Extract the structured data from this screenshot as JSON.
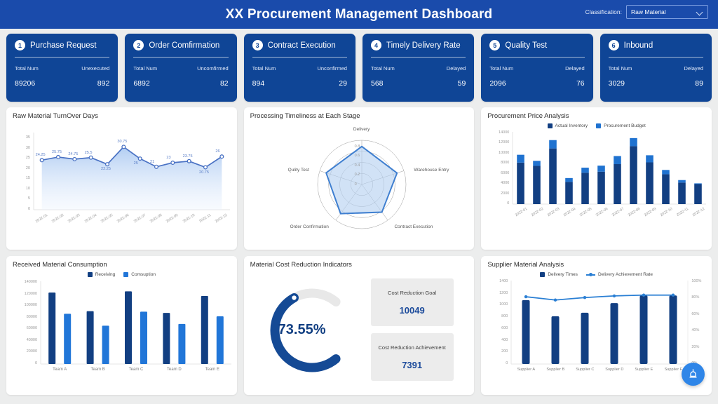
{
  "header": {
    "title": "XX Procurement Management Dashboard",
    "classification_label": "Classification:",
    "classification_value": "Raw Material",
    "chevron_icon": "chevron-down-icon",
    "bg_color": "#1a4bab"
  },
  "kpi_cards": [
    {
      "num": "1",
      "title": "Purchase Request",
      "left_label": "Total Num",
      "left_value": "89206",
      "right_label": "Unexecuted",
      "right_value": "892"
    },
    {
      "num": "2",
      "title": "Order Comfirmation",
      "left_label": "Total Num",
      "left_value": "6892",
      "right_label": "Uncomfirmed",
      "right_value": "82"
    },
    {
      "num": "3",
      "title": "Contract Execution",
      "left_label": "Total Num",
      "left_value": "894",
      "right_label": "Unconfirmed",
      "right_value": "29"
    },
    {
      "num": "4",
      "title": "Timely Delivery Rate",
      "left_label": "Total Num",
      "left_value": "568",
      "right_label": "Delayed",
      "right_value": "59"
    },
    {
      "num": "5",
      "title": "Quality Test",
      "left_label": "Total Num",
      "left_value": "2096",
      "right_label": "Delayed",
      "right_value": "76"
    },
    {
      "num": "6",
      "title": "Inbound",
      "left_label": "Total Num",
      "left_value": "3029",
      "right_label": "Delayed",
      "right_value": "89"
    }
  ],
  "fab": {
    "icon": "alarm-icon",
    "color": "#2f86e8"
  },
  "chart_data": [
    {
      "id": "turnover",
      "type": "line",
      "title": "Raw Material TurnOver Days",
      "xlabel": "",
      "ylabel": "",
      "ylim": [
        0,
        35
      ],
      "yticks": [
        0,
        5,
        10,
        15,
        20,
        25,
        30,
        35
      ],
      "grid": false,
      "legend": "none",
      "area_fill": true,
      "color": "#4a72c4",
      "categories": [
        "2022-01",
        "2022-02",
        "2022-03",
        "2022-04",
        "2022-05",
        "2022-06",
        "2022-07",
        "2022-08",
        "2022-09",
        "2022-10",
        "2022-11",
        "2022-12"
      ],
      "values": [
        24.25,
        25.75,
        24.75,
        25.5,
        22.25,
        30.75,
        25,
        21,
        23,
        23.75,
        20.75,
        26
      ],
      "point_labels": [
        "24.25",
        "25.75",
        "24.75",
        "25.5",
        "22.25",
        "30.75",
        "25",
        "21",
        "23",
        "23.75",
        "20.75",
        "26"
      ]
    },
    {
      "id": "radar",
      "type": "radar",
      "title": "Processing Timeliness at Each Stage",
      "rlim": [
        0,
        0.8
      ],
      "rticks": [
        "0",
        "0.2",
        "0.4",
        "0.6",
        "0.8"
      ],
      "legend": "none",
      "color": "#3f7fd0",
      "categories": [
        "Delivery",
        "Warehouse Entry",
        "Contract Execution",
        "Order Confirmation",
        "Qulity Test"
      ],
      "values": [
        0.8,
        0.78,
        0.72,
        0.76,
        0.79
      ]
    },
    {
      "id": "price",
      "type": "bar",
      "stacked": true,
      "title": "Procurement Price Analysis",
      "ylim": [
        0,
        14000
      ],
      "yticks": [
        0,
        2000,
        4000,
        6000,
        8000,
        10000,
        12000,
        14000
      ],
      "legend": "top",
      "categories": [
        "2022-01",
        "2022-02",
        "2022-03",
        "2022-04",
        "2022-05",
        "2022-06",
        "2022-07",
        "2022-08",
        "2022-09",
        "2022-10",
        "2022-11",
        "2022-12"
      ],
      "series": [
        {
          "name": "Actual Inventory",
          "color": "#123f82",
          "values": [
            8200,
            7550,
            11000,
            4400,
            6200,
            6400,
            7900,
            11450,
            8250,
            5900,
            4250,
            3950
          ]
        },
        {
          "name": "Procurement Budget",
          "color": "#1f72d0",
          "values": [
            1550,
            1000,
            1650,
            750,
            1000,
            1200,
            1600,
            1600,
            1400,
            850,
            500,
            150
          ]
        }
      ],
      "totals": [
        9750,
        8550,
        12650,
        5150,
        7200,
        7600,
        9500,
        13050,
        9650,
        6750,
        4750,
        4100
      ]
    },
    {
      "id": "consumption",
      "type": "bar",
      "stacked": false,
      "title": "Received Material Consumption",
      "ylim": [
        0,
        140000
      ],
      "yticks": [
        0,
        20000,
        40000,
        60000,
        80000,
        100000,
        120000,
        140000
      ],
      "legend": "top",
      "categories": [
        "Team A",
        "Team B",
        "Team C",
        "Team D",
        "Team E"
      ],
      "series": [
        {
          "name": "Receiving",
          "color": "#123f82",
          "values": [
            123000,
            91000,
            125000,
            88000,
            117000
          ]
        },
        {
          "name": "Comsuption",
          "color": "#2176d8",
          "values": [
            86500,
            66000,
            90000,
            69000,
            82000
          ]
        }
      ]
    },
    {
      "id": "gauge",
      "type": "gauge",
      "title": "Material Cost Reduction Indicators",
      "value": 73.55,
      "value_label": "73.55%",
      "color": "#154a95",
      "track_color": "#e8e8e8",
      "stats": [
        {
          "label": "Cost Reduction Goal",
          "value": "10049"
        },
        {
          "label": "Cost Reduction Achievement",
          "value": "7391"
        }
      ]
    },
    {
      "id": "supplier",
      "type": "bar",
      "combo": "line",
      "title": "Supplier Material Analysis",
      "ylim": [
        0,
        1400
      ],
      "yticks": [
        0,
        200,
        400,
        600,
        800,
        1000,
        1200,
        1400
      ],
      "y2lim": [
        0,
        100
      ],
      "y2ticks": [
        "0%",
        "20%",
        "40%",
        "60%",
        "80%",
        "100%"
      ],
      "legend": "top",
      "categories": [
        "Supplier A",
        "Supplier B",
        "Supplier C",
        "Supplier D",
        "Supplier E",
        "Supplier F"
      ],
      "series": [
        {
          "name": "Delivery Times",
          "type": "bar",
          "color": "#123f82",
          "values": [
            1090,
            815,
            875,
            1040,
            1170,
            1170
          ]
        },
        {
          "name": "Delivery Achievement Rate",
          "type": "line",
          "color": "#2a7fd4",
          "values": [
            82,
            78,
            81,
            83,
            84,
            84
          ]
        }
      ]
    }
  ]
}
